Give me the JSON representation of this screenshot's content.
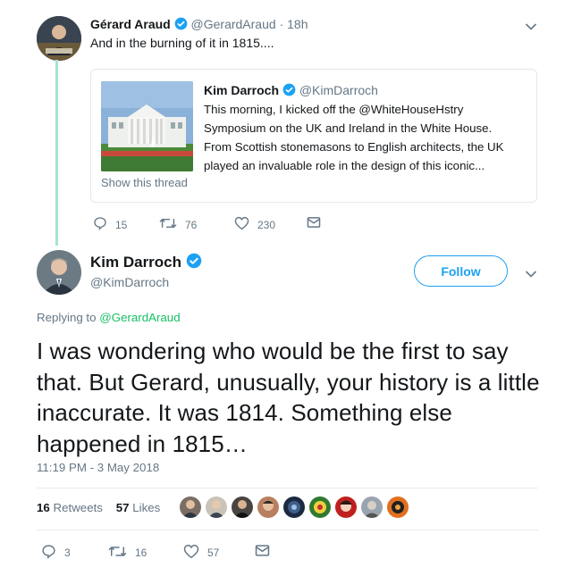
{
  "parent_tweet": {
    "display_name": "Gérard Araud",
    "handle": "@GerardAraud",
    "separator": "·",
    "time_ago": "18h",
    "text": "And in the burning of it in 1815....",
    "counts": {
      "replies": "15",
      "retweets": "76",
      "likes": "230"
    }
  },
  "quoted_tweet": {
    "display_name": "Kim Darroch",
    "handle": "@KimDarroch",
    "lines": [
      "This morning, I kicked off the @WhiteHouseHstry",
      "Symposium on the UK and Ireland in the White House.",
      "From Scottish stonemasons to English architects, the UK",
      "played an invaluable role in the design of this iconic..."
    ],
    "show_thread": "Show this thread"
  },
  "main_tweet": {
    "display_name": "Kim Darroch",
    "handle": "@KimDarroch",
    "follow_label": "Follow",
    "replying_prefix": "Replying to",
    "replying_handle": "@GerardAraud",
    "text": "I was wondering who would be the first to say that. But Gerard, unusually, your history is a little inaccurate. It was 1814. Something else happened in 1815…",
    "timestamp": "11:19 PM - 3 May 2018",
    "stats": {
      "retweets_count": "16",
      "retweets_label": "Retweets",
      "likes_count": "57",
      "likes_label": "Likes"
    },
    "counts": {
      "replies": "3",
      "retweets": "16",
      "likes": "57"
    }
  },
  "colors": {
    "accent": "#1da1f2",
    "green_link": "#17bf63",
    "thread_line": "#a6e3d2",
    "muted": "#657786"
  }
}
